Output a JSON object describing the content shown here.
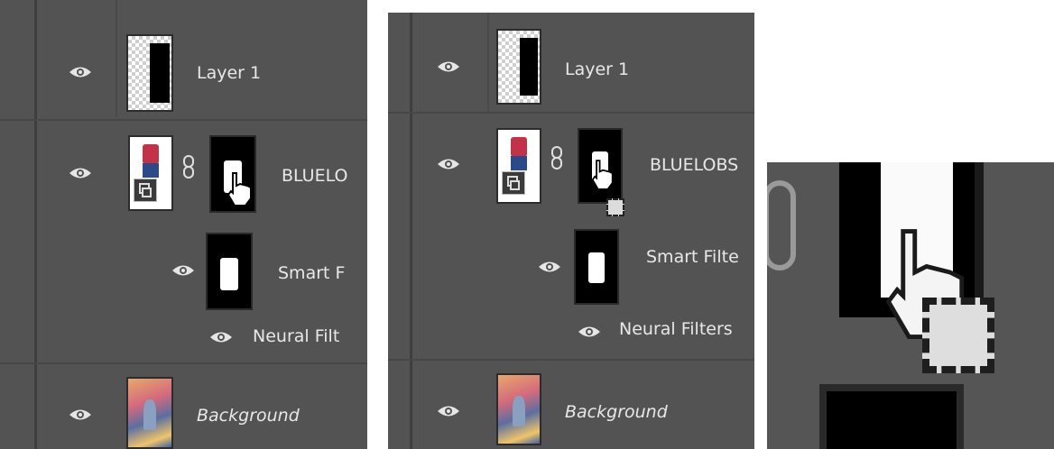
{
  "panel_a": {
    "layers": [
      {
        "name": "Layer 1"
      },
      {
        "name": "BLUELO"
      },
      {
        "name": "Smart F"
      },
      {
        "name": "Neural Filt"
      },
      {
        "name": "Background"
      }
    ]
  },
  "panel_b": {
    "layers": [
      {
        "name": "Layer 1"
      },
      {
        "name": "BLUELOBS"
      },
      {
        "name": "Smart Filte"
      },
      {
        "name": "Neural Filters"
      },
      {
        "name": "Background"
      }
    ]
  },
  "icons": {
    "visibility": "eye-icon",
    "link": "chain-link-icon",
    "smart_object": "smart-object-badge-icon",
    "cursor": "hand-pointer-cursor-icon",
    "drag": "drag-copy-box-icon"
  }
}
